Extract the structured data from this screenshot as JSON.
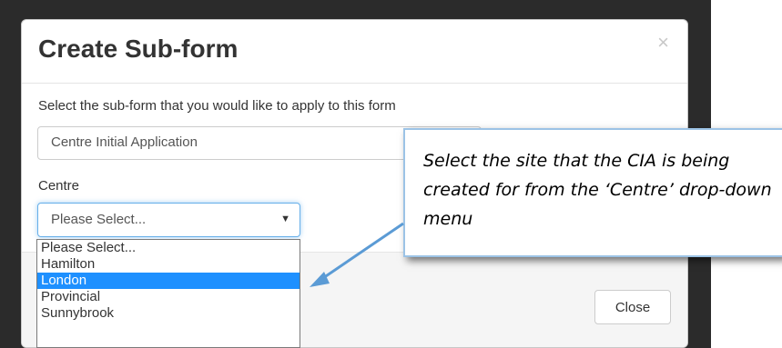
{
  "modal": {
    "title": "Create Sub-form",
    "close_symbol": "×",
    "help_text": "Select the sub-form that you would like to apply to this form",
    "subform_value": "Centre Initial Application",
    "centre_label": "Centre",
    "centre_select_value": "Please Select...",
    "close_button": "Close"
  },
  "centre_options": [
    "Please Select...",
    "Hamilton",
    "London",
    "Provincial",
    "Sunnybrook"
  ],
  "centre_highlighted": "London",
  "callout": {
    "text": "Select the site that the CIA is being created for from the ‘Centre’ drop-down menu"
  },
  "colors": {
    "highlight": "#1e90ff",
    "focus_border": "#66afe9",
    "callout_border": "#9cc3e6",
    "arrow": "#5b9bd5"
  },
  "icons": {
    "close": "close-icon",
    "caret": "chevron-down-icon",
    "arrow": "arrow-pointer"
  }
}
